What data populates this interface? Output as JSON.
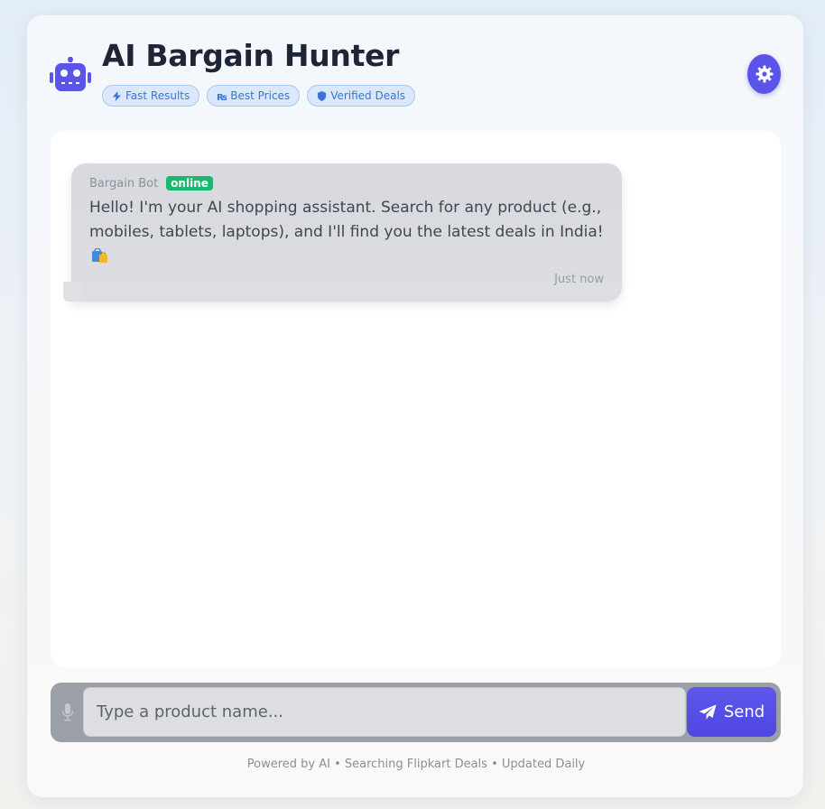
{
  "header": {
    "title": "AI Bargain Hunter",
    "badges": [
      {
        "label": "Fast Results",
        "icon": "bolt-icon"
      },
      {
        "label": "Best Prices",
        "icon": "rupee-icon"
      },
      {
        "label": "Verified Deals",
        "icon": "shield-icon"
      }
    ],
    "settings_icon": "gear-icon"
  },
  "chat": {
    "messages": [
      {
        "sender": "Bargain Bot",
        "status": "online",
        "text": "Hello! I'm your AI shopping assistant. Search for any product (e.g., mobiles, tablets, laptops), and I'll find you the latest deals in India!",
        "emoji_icon": "shopping-bags-icon",
        "time": "Just now"
      }
    ]
  },
  "input": {
    "placeholder": "Type a product name...",
    "value": "",
    "send_label": "Send"
  },
  "footer": {
    "text": "Powered by AI • Searching Flipkart Deals • Updated Daily"
  },
  "colors": {
    "accent": "#5b54e8",
    "online": "#16b96f",
    "badge_text": "#3b74d6",
    "title": "#1e2636"
  }
}
